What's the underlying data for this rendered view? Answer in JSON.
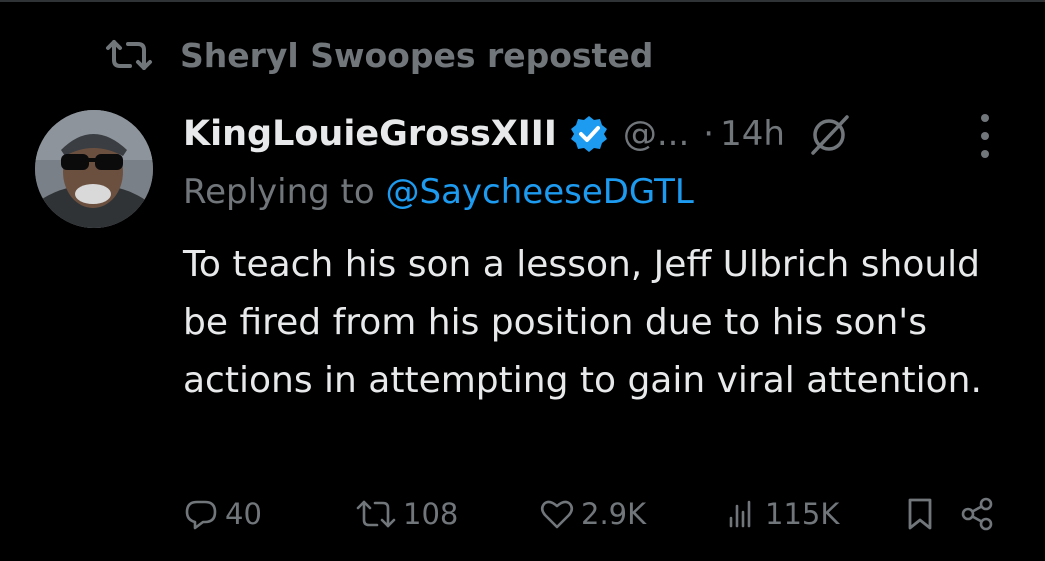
{
  "repost": {
    "icon": "repost-icon",
    "text": "Sheryl Swoopes reposted"
  },
  "author": {
    "name": "KingLouieGrossXIII",
    "verified_color": "#1d9bf0",
    "handle": "@...",
    "separator": "·",
    "time": "14h"
  },
  "reply": {
    "prefix": "Replying to ",
    "target": "@SaycheeseDGTL"
  },
  "tweet": {
    "text": "To teach his son a lesson, Jeff Ulbrich should be fired from his position due to his son's actions in attempting to gain viral attention."
  },
  "actions": {
    "replies": "40",
    "reposts": "108",
    "likes": "2.9K",
    "views": "115K"
  },
  "colors": {
    "accent": "#1d9bf0",
    "muted": "#71767b",
    "text": "#e7e9ea",
    "background": "#000000"
  }
}
